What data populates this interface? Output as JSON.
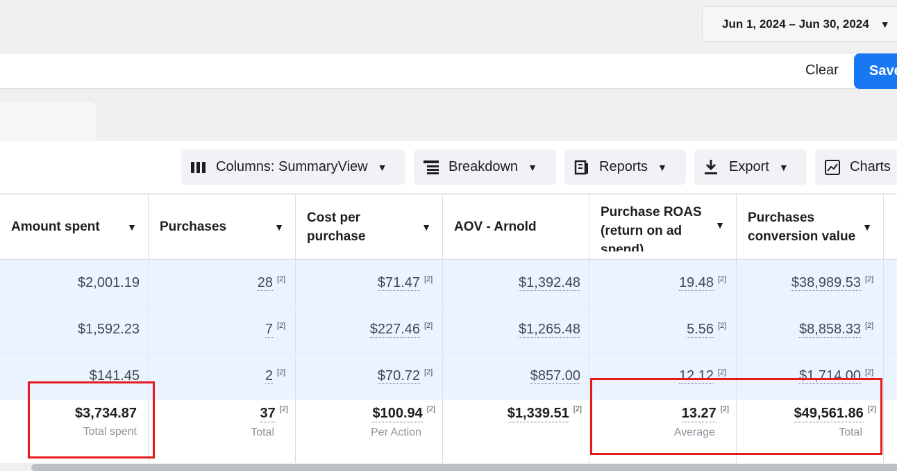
{
  "date_range": {
    "label": "Jun 1, 2024 – Jun 30, 2024"
  },
  "filter_bar": {
    "clear_label": "Clear",
    "save_label": "Save"
  },
  "toolbar": {
    "columns_label": "Columns: SummaryView",
    "breakdown_label": "Breakdown",
    "reports_label": "Reports",
    "export_label": "Export",
    "charts_label": "Charts"
  },
  "table": {
    "headers": [
      "Amount spent",
      "Purchases",
      "Cost per purchase",
      "AOV - Arnold",
      "Purchase ROAS (return on ad spend)",
      "Purchases conversion value"
    ],
    "superscript": "[2]",
    "rows": [
      [
        "$2,001.19",
        "28",
        "$71.47",
        "$1,392.48",
        "19.48",
        "$38,989.53"
      ],
      [
        "$1,592.23",
        "7",
        "$227.46",
        "$1,265.48",
        "5.56",
        "$8,858.33"
      ],
      [
        "$141.45",
        "2",
        "$70.72",
        "$857.00",
        "12.12",
        "$1,714.00"
      ]
    ],
    "totals": {
      "amount_spent": "$3,734.87",
      "amount_spent_sub": "Total spent",
      "purchases": "37",
      "purchases_sub": "Total",
      "cost_per_purchase": "$100.94",
      "cost_per_purchase_sub": "Per Action",
      "aov": "$1,339.51",
      "roas": "13.27",
      "roas_sub": "Average",
      "conversion_value": "$49,561.86",
      "conversion_value_sub": "Total"
    }
  },
  "colors": {
    "accent": "#1877f2",
    "highlight_box": "#e41c1c",
    "row_bg": "#ebf3ff"
  }
}
